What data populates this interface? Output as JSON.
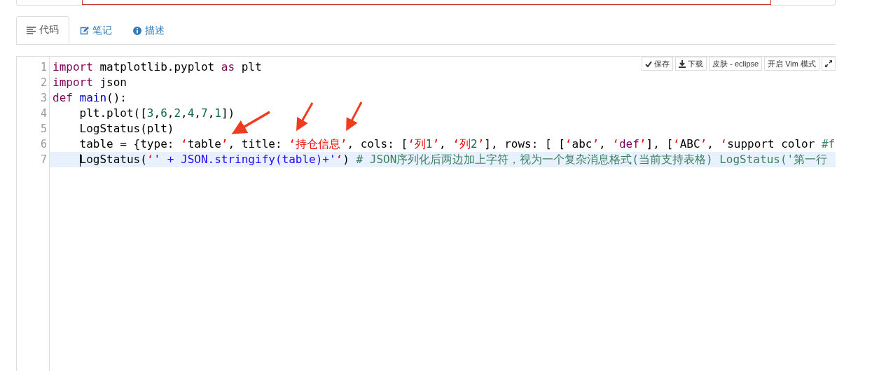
{
  "tabs": [
    {
      "label": "代码",
      "selected": true
    },
    {
      "label": "笔记",
      "selected": false
    },
    {
      "label": "描述",
      "selected": false
    }
  ],
  "toolbar": [
    {
      "label": "保存",
      "kind": "button"
    },
    {
      "label": "下载",
      "kind": "button"
    },
    {
      "label": "皮肤 - eclipse",
      "kind": "button"
    },
    {
      "label": "开启 Vim 模式",
      "kind": "button"
    },
    {
      "kind": "expand"
    }
  ],
  "editor": {
    "lines": [
      {
        "number": "1",
        "active": false,
        "tokens": [
          {
            "kind": "keyword",
            "text": "import"
          },
          {
            "kind": "plain",
            "text": " matplotlib.pyplot "
          },
          {
            "kind": "keyword",
            "text": "as"
          },
          {
            "kind": "plain",
            "text": " plt"
          }
        ]
      },
      {
        "number": "2",
        "active": false,
        "tokens": [
          {
            "kind": "keyword",
            "text": "import"
          },
          {
            "kind": "plain",
            "text": " json"
          }
        ]
      },
      {
        "number": "3",
        "active": false,
        "tokens": [
          {
            "kind": "keyword",
            "text": "def"
          },
          {
            "kind": "def",
            "text": " main"
          },
          {
            "kind": "plain",
            "text": "():"
          }
        ]
      },
      {
        "number": "4",
        "active": false,
        "tokens": [
          {
            "kind": "plain",
            "text": "    plt.plot(["
          },
          {
            "kind": "number",
            "text": "3"
          },
          {
            "kind": "plain",
            "text": ","
          },
          {
            "kind": "number",
            "text": "6"
          },
          {
            "kind": "plain",
            "text": ","
          },
          {
            "kind": "number",
            "text": "2"
          },
          {
            "kind": "plain",
            "text": ","
          },
          {
            "kind": "number",
            "text": "4"
          },
          {
            "kind": "plain",
            "text": ","
          },
          {
            "kind": "number",
            "text": "7"
          },
          {
            "kind": "plain",
            "text": ","
          },
          {
            "kind": "number",
            "text": "1"
          },
          {
            "kind": "plain",
            "text": "])"
          }
        ]
      },
      {
        "number": "5",
        "active": false,
        "tokens": [
          {
            "kind": "plain",
            "text": "    LogStatus(plt)"
          }
        ]
      },
      {
        "number": "6",
        "active": false,
        "tokens": [
          {
            "kind": "plain",
            "text": "    table = {type: "
          },
          {
            "kind": "error",
            "text": "‘"
          },
          {
            "kind": "plain",
            "text": "table"
          },
          {
            "kind": "error",
            "text": "’"
          },
          {
            "kind": "plain",
            "text": ", title: "
          },
          {
            "kind": "error",
            "text": "‘持仓信息’"
          },
          {
            "kind": "plain",
            "text": ", cols: ["
          },
          {
            "kind": "error",
            "text": "‘列"
          },
          {
            "kind": "number",
            "text": "1"
          },
          {
            "kind": "error",
            "text": "’"
          },
          {
            "kind": "plain",
            "text": ", "
          },
          {
            "kind": "error",
            "text": "‘列"
          },
          {
            "kind": "number",
            "text": "2"
          },
          {
            "kind": "error",
            "text": "’"
          },
          {
            "kind": "plain",
            "text": "], rows: [ ["
          },
          {
            "kind": "error",
            "text": "‘"
          },
          {
            "kind": "plain",
            "text": "abc"
          },
          {
            "kind": "error",
            "text": "’"
          },
          {
            "kind": "plain",
            "text": ", "
          },
          {
            "kind": "error",
            "text": "‘"
          },
          {
            "kind": "keyword",
            "text": "def"
          },
          {
            "kind": "error",
            "text": "’"
          },
          {
            "kind": "plain",
            "text": "], ["
          },
          {
            "kind": "error",
            "text": "‘"
          },
          {
            "kind": "plain",
            "text": "ABC"
          },
          {
            "kind": "error",
            "text": "’"
          },
          {
            "kind": "plain",
            "text": ", "
          },
          {
            "kind": "error",
            "text": "‘"
          },
          {
            "kind": "plain",
            "text": "support color "
          },
          {
            "kind": "comment",
            "text": "#f"
          }
        ]
      },
      {
        "number": "7",
        "active": true,
        "tokens": [
          {
            "kind": "plain",
            "text": "    LogStatus("
          },
          {
            "kind": "error",
            "text": "‘"
          },
          {
            "kind": "string",
            "text": "' + JSON.stringify(table)+'"
          },
          {
            "kind": "error",
            "text": "‘"
          },
          {
            "kind": "plain",
            "text": ") "
          },
          {
            "kind": "comment",
            "text": "# JSON序列化后两边加上字符，视为一个复杂消息格式(当前支持表格) LogStatus('第一行"
          }
        ]
      }
    ]
  }
}
